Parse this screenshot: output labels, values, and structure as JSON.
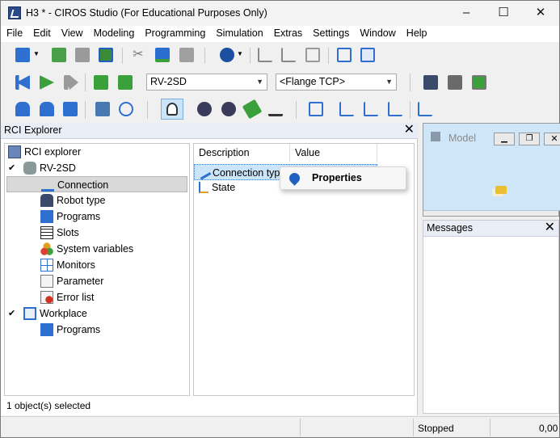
{
  "window": {
    "title": "H3 * - CIROS Studio (For Educational Purposes Only)",
    "controls": {
      "minimize": "–",
      "maximize": "☐",
      "close": "✕"
    }
  },
  "menu": [
    "File",
    "Edit",
    "View",
    "Modeling",
    "Programming",
    "Simulation",
    "Extras",
    "Settings",
    "Window",
    "Help"
  ],
  "toolbar": {
    "robot_select": "RV-2SD",
    "tcp_select": "<Flange TCP>"
  },
  "rci_explorer": {
    "title": "RCI Explorer",
    "close": "✕",
    "tree": {
      "root": "RCI explorer",
      "robot": "RV-2SD",
      "robot_children": [
        "Connection",
        "Robot type",
        "Programs",
        "Slots",
        "System variables",
        "Monitors",
        "Parameter",
        "Error list"
      ],
      "workplace": "Workplace",
      "workplace_children": [
        "Programs"
      ],
      "selected": "Connection"
    },
    "grid": {
      "columns": [
        "Description",
        "Value"
      ],
      "rows": [
        "Connection type",
        "State"
      ]
    },
    "status": "1 object(s) selected"
  },
  "context_menu": {
    "items": [
      "Properties"
    ]
  },
  "model_window": {
    "title": "Model"
  },
  "messages": {
    "title": "Messages",
    "close": "✕"
  },
  "statusbar": {
    "state": "Stopped",
    "value": "0,00"
  },
  "colors": {
    "selection": "#cce4f7",
    "tree_selected": "#d9d9d9",
    "model_bg": "#cfe6f8",
    "accent_blue": "#1f5fbf"
  }
}
